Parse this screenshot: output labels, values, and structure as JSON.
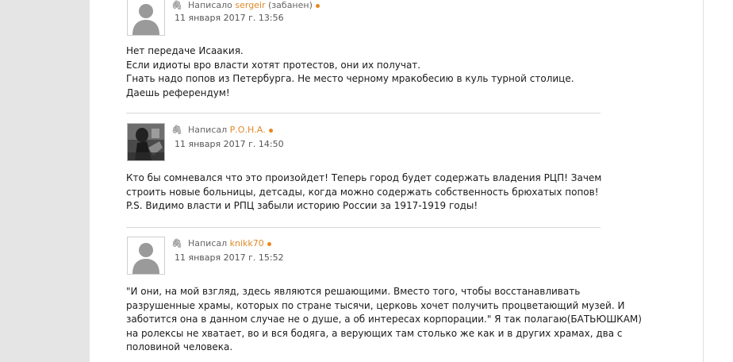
{
  "posts": [
    {
      "wrote_label": "Написало",
      "username": "sergeir",
      "note": "(забанен)",
      "date": "11 января 2017 г. 13:56",
      "avatar": "default-avatar",
      "lines": [
        "Нет передаче Исаакия.",
        "Если идиоты вро власти хотят протестов, они их получат.",
        "Гнать надо попов из Петербурга. Не место черному мракобесию в куль турной столице.",
        "Даешь референдум!"
      ]
    },
    {
      "wrote_label": "Написал",
      "username": "Р.О.Н.А.",
      "note": "",
      "date": "11 января 2017 г. 14:50",
      "avatar": "photo-avatar",
      "lines": [
        "Кто бы сомневался что это произойдет! Теперь город будет содержать владения РЦП! Зачем",
        "строить новые больницы, детсады, когда можно содержать собственность брюхатых попов!",
        "P.S. Видимо власти и РПЦ забыли историю России за 1917-1919 годы!"
      ]
    },
    {
      "wrote_label": "Написал",
      "username": "knikk70",
      "note": "",
      "date": "11 января 2017 г. 15:52",
      "avatar": "default-avatar",
      "lines": [
        "\"И они, на мой взгляд, здесь являются решающими. Вместо того, чтобы восстанавливать",
        "разрушенные храмы, которых по стране тысячи, церковь хочет получить процветающий музей. И",
        "заботится она в данном случае не о душе, а об интересах корпорации.\" Я так полагаю(БАТЬЮШКАМ)",
        "на ролексы не хватает, во и вся бодяга, а верующих там столько же как и в других храмах, два с",
        "половиной человека."
      ]
    }
  ],
  "colors": {
    "username": "#e08a2a",
    "status_dot": "#e8871e",
    "sidebar": "#e5e5e5"
  },
  "icons": {
    "attachment": "paperclip-icon",
    "online": "status-dot-icon"
  }
}
